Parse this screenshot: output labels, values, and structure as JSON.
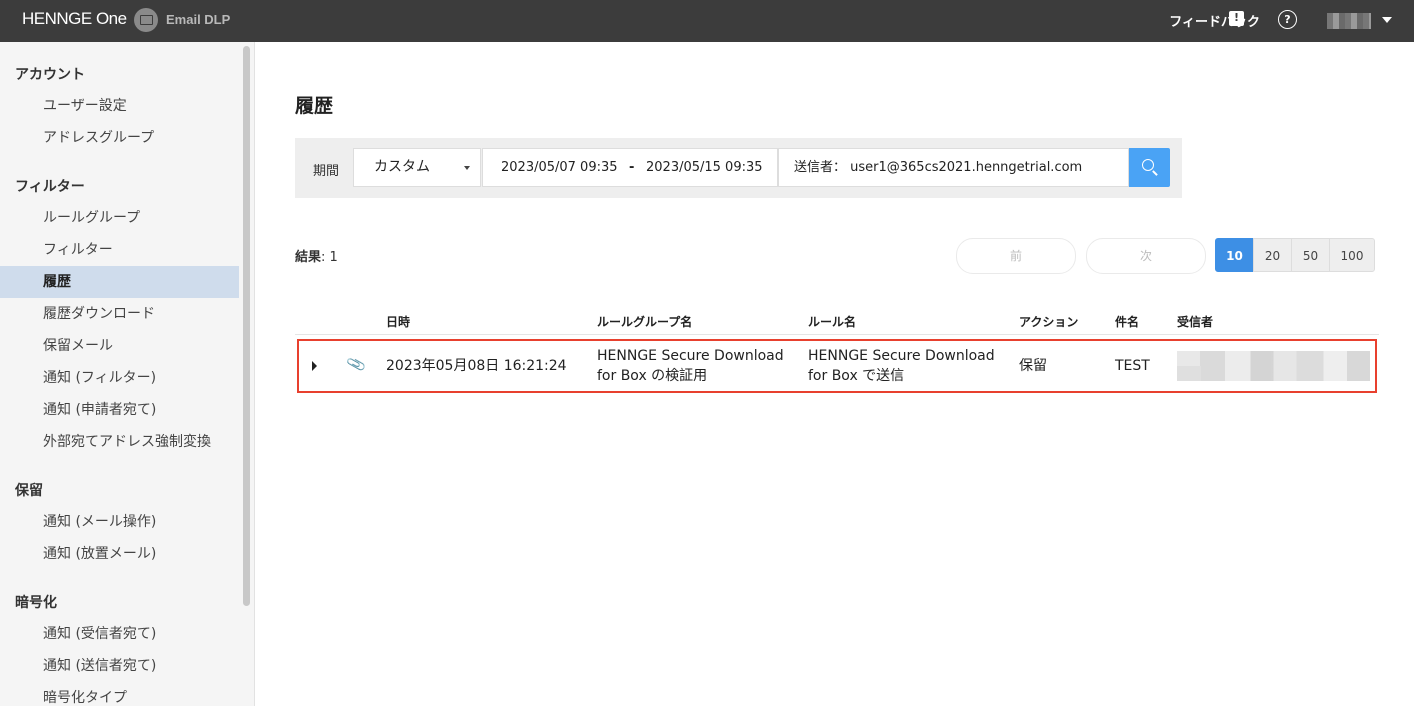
{
  "topbar": {
    "brand": "HENNGE One",
    "product": "Email DLP",
    "feedback_label": "フィードバック",
    "feedback_icon_glyph": "!",
    "help_icon_glyph": "?"
  },
  "sidebar": {
    "sections": [
      {
        "title": "アカウント",
        "items": [
          "ユーザー設定",
          "アドレスグループ"
        ]
      },
      {
        "title": "フィルター",
        "items": [
          "ルールグループ",
          "フィルター",
          "履歴",
          "履歴ダウンロード",
          "保留メール",
          "通知 (フィルター)",
          "通知 (申請者宛て)",
          "外部宛てアドレス強制変換"
        ]
      },
      {
        "title": "保留",
        "items": [
          "通知 (メール操作)",
          "通知 (放置メール)"
        ]
      },
      {
        "title": "暗号化",
        "items": [
          "通知 (受信者宛て)",
          "通知 (送信者宛て)",
          "暗号化タイプ"
        ]
      }
    ],
    "active_item": "履歴"
  },
  "main": {
    "title": "履歴",
    "filter": {
      "period_label": "期間",
      "period_value": "カスタム",
      "date_start": "2023/05/07  09:35",
      "date_dash": "-",
      "date_end": "2023/05/15  09:35",
      "sender": "送信者：  user1@365cs2021.henngetrial.com"
    },
    "results_label": "結果",
    "results_count": ": 1",
    "prev_label": "前",
    "next_label": "次",
    "page_sizes": [
      "10",
      "20",
      "50",
      "100"
    ],
    "active_page_size": "10",
    "table": {
      "headers": [
        "日時",
        "ルールグループ名",
        "ルール名",
        "アクション",
        "件名",
        "受信者"
      ],
      "rows": [
        {
          "datetime": "2023年05月08日 16:21:24",
          "rule_group_line1": "HENNGE Secure Download",
          "rule_group_line2": "for Box の検証用",
          "rule_line1": "HENNGE Secure Download",
          "rule_line2": "for Box で送信",
          "action": "保留",
          "subject": "TEST",
          "recipient": ""
        }
      ]
    }
  },
  "colors": {
    "topbar": "#3c3c3c",
    "accent": "#4aa3f5",
    "active_page": "#3d8fe5",
    "highlight_border": "#e8402e",
    "sidebar_active": "#cfdcec"
  }
}
